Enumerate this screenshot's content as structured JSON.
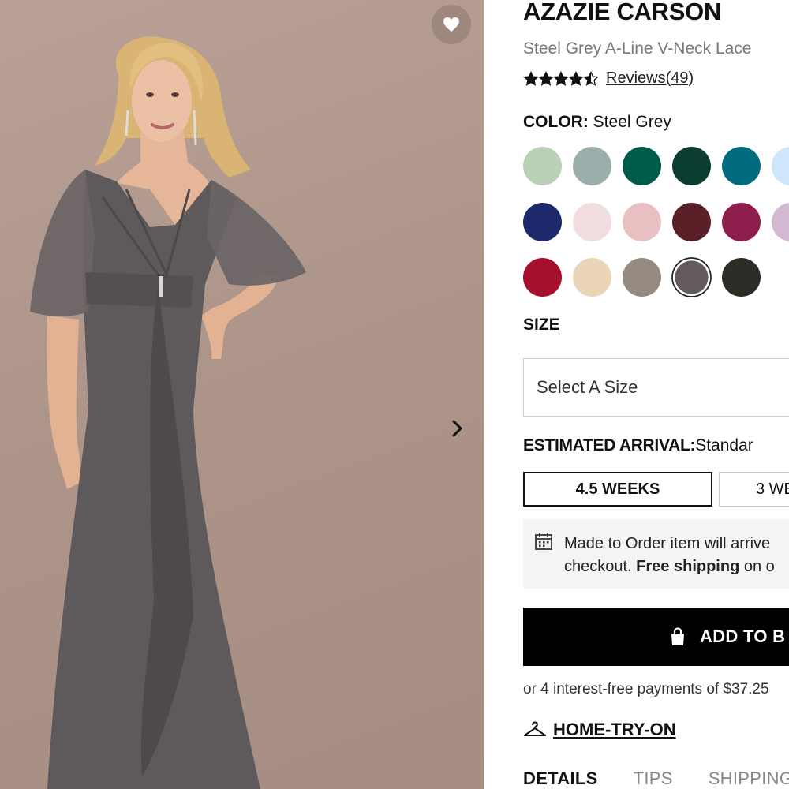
{
  "product": {
    "title": "AZAZIE CARSON",
    "subtitle": "Steel Grey A-Line V-Neck Lace",
    "rating": 4.5,
    "reviews_link": "Reviews(49)"
  },
  "color": {
    "label": "COLOR:",
    "selected": "Steel Grey",
    "swatches": [
      {
        "hex": "#b9d2b6"
      },
      {
        "hex": "#9aafab"
      },
      {
        "hex": "#005c4a"
      },
      {
        "hex": "#0c3d31"
      },
      {
        "hex": "#006c7e"
      },
      {
        "hex": "#cfe5fb"
      },
      {
        "hex": "#1c2a6b"
      },
      {
        "hex": "#f1dde0"
      },
      {
        "hex": "#e9bfc1"
      },
      {
        "hex": "#5b1f27"
      },
      {
        "hex": "#8e1e4c"
      },
      {
        "hex": "#d3b8d2"
      },
      {
        "hex": "#a5102b"
      },
      {
        "hex": "#ead6b6"
      },
      {
        "hex": "#958b80"
      },
      {
        "hex": "#625a5e"
      },
      {
        "hex": "#2a2e27"
      }
    ]
  },
  "size": {
    "heading": "SIZE",
    "placeholder": "Select A Size"
  },
  "arrival": {
    "label": "ESTIMATED ARRIVAL:",
    "value": "Standar",
    "options": [
      "4.5 WEEKS",
      "3 WE"
    ]
  },
  "notice": {
    "line1": "Made to Order item will arrive",
    "line2_pre": "checkout.",
    "line2_bold": "Free shipping",
    "line2_post": "on o"
  },
  "add_to_bag": "ADD TO B",
  "installments": "or 4 interest-free payments of $37.25",
  "home_try_on": "HOME-TRY-ON",
  "tabs": [
    "DETAILS",
    "TIPS",
    "SHIPPING"
  ],
  "icons": {
    "favorite": "heart-icon",
    "next": "chevron-right-icon",
    "calendar": "calendar-icon",
    "bag": "shopping-bag-icon",
    "hanger": "hanger-icon"
  }
}
